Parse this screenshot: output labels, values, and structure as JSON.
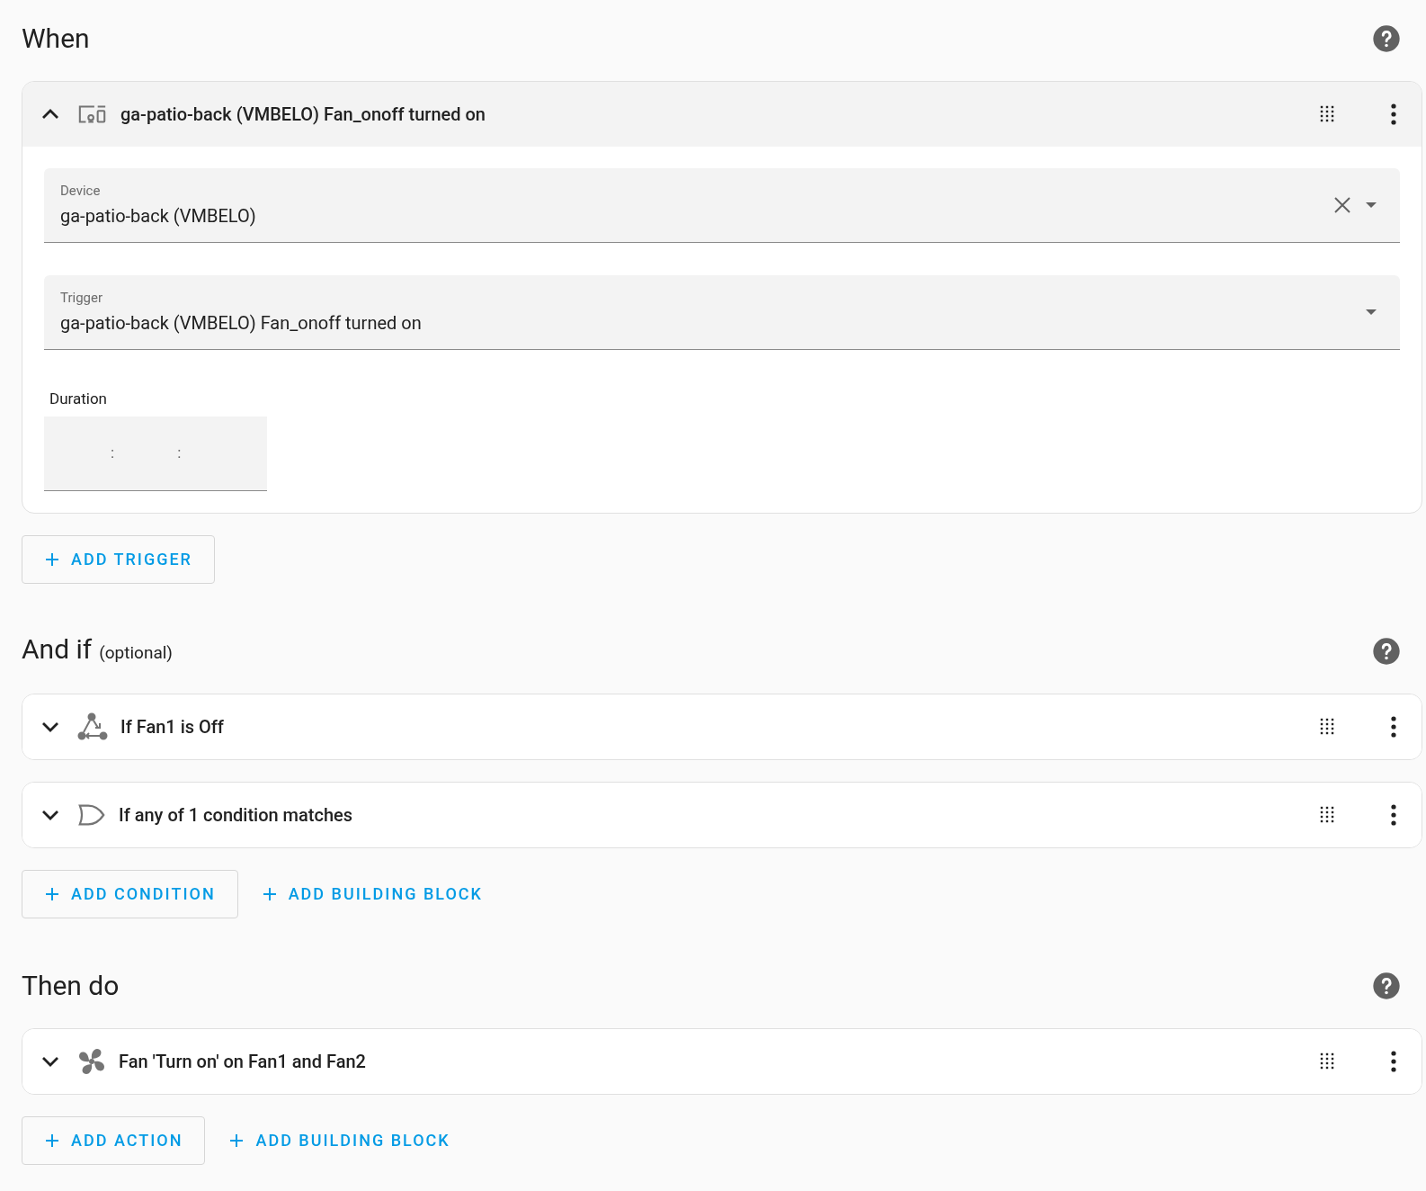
{
  "sections": [
    {
      "title": "When",
      "items": [
        {
          "kind": "device",
          "title": "ga-patio-back (VMBELO) Fan_onoff turned on",
          "expanded": true,
          "fields": [
            {
              "kind": "select",
              "label": "Device",
              "value": "ga-patio-back (VMBELO)",
              "clearable": true
            },
            {
              "kind": "select",
              "label": "Trigger",
              "value": "ga-patio-back (VMBELO) Fan_onoff turned on",
              "clearable": false
            },
            {
              "kind": "duration",
              "label": "Duration",
              "separators": [
                ":",
                ":"
              ]
            }
          ]
        }
      ],
      "buttons": [
        {
          "kind": "outlined",
          "label": "ADD TRIGGER"
        }
      ]
    },
    {
      "title": "And if",
      "subtitle": "(optional)",
      "items": [
        {
          "kind": "state",
          "title": "If Fan1 is Off",
          "expanded": false
        },
        {
          "kind": "or",
          "title": "If any of 1 condition matches",
          "expanded": false
        }
      ],
      "buttons": [
        {
          "kind": "outlined",
          "label": "ADD CONDITION"
        },
        {
          "kind": "text",
          "label": "ADD BUILDING BLOCK"
        }
      ]
    },
    {
      "title": "Then do",
      "items": [
        {
          "kind": "fan",
          "title": "Fan 'Turn on' on Fan1 and Fan2",
          "expanded": false
        }
      ],
      "buttons": [
        {
          "kind": "outlined",
          "label": "ADD ACTION"
        },
        {
          "kind": "text",
          "label": "ADD BUILDING BLOCK"
        }
      ]
    }
  ]
}
